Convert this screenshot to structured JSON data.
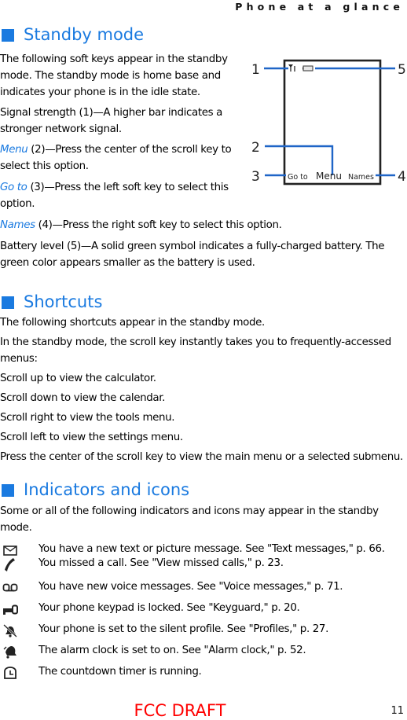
{
  "running_header": "Phone at a glance",
  "colors": {
    "accent": "#1a7ae0",
    "text": "#000000",
    "draft": "#ff0000"
  },
  "standby": {
    "title": "Standby mode",
    "intro_lines": [
      "The following soft keys appear in the standby",
      "mode. The standby mode is home base and",
      "indicates your phone is in the idle state."
    ],
    "signal_lines": [
      "Signal strength (1)—A higher bar indicates a",
      "stronger network signal."
    ],
    "menu": {
      "key": "Menu",
      "line1_rest": " (2)—Press the center of the scroll key to",
      "line2": "select this option."
    },
    "goto": {
      "key": "Go to",
      "line1_rest": " (3)—Press the left soft key to select this",
      "line2": "option."
    },
    "names": {
      "key": "Names",
      "rest": " (4)—Press the right soft key to select this option."
    },
    "battery_lines": [
      "Battery level (5)—A solid green symbol indicates a fully-charged battery. The",
      "green color appears smaller as the battery is used."
    ],
    "diagram": {
      "callouts": [
        "1",
        "2",
        "3",
        "4",
        "5"
      ],
      "softkey_left": "Go to",
      "softkey_center": "Menu",
      "softkey_right": "Names",
      "icons": [
        "signal-icon",
        "battery-icon"
      ]
    }
  },
  "shortcuts": {
    "title": "Shortcuts",
    "lines": [
      "The following shortcuts appear in the standby mode.",
      "In the standby mode, the scroll key instantly takes you to frequently-accessed",
      "menus:",
      "Scroll up to view the calculator.",
      "Scroll down to view the calendar.",
      "Scroll right to view the tools menu.",
      "Scroll left to view the settings menu.",
      "Press the center of the scroll key to view the main menu or a selected submenu."
    ]
  },
  "indicators": {
    "title": "Indicators and icons",
    "intro_lines": [
      "Some or all of the following indicators and icons may appear in the standby",
      "mode."
    ],
    "items": [
      {
        "icon": "envelope-icon",
        "text": "You have a new text or picture message. See \"Text messages,\" p. 66."
      },
      {
        "icon": "missed-call-handset-icon",
        "text": "You missed a call. See \"View missed calls,\" p. 23."
      },
      {
        "icon": "voicemail-icon",
        "text": "You have new voice messages. See \"Voice messages,\" p. 71."
      },
      {
        "icon": "key-lock-icon",
        "text": "Your phone keypad is locked. See \"Keyguard,\" p. 20."
      },
      {
        "icon": "silent-bell-icon",
        "text": "Your phone is set to the silent profile. See \"Profiles,\" p. 27."
      },
      {
        "icon": "alarm-bell-icon",
        "text": "The alarm clock is set to on. See \"Alarm clock,\" p. 52."
      },
      {
        "icon": "countdown-timer-icon",
        "text": "The countdown timer is running."
      }
    ]
  },
  "footer": {
    "draft_label": "FCC DRAFT",
    "page_number": "11"
  }
}
